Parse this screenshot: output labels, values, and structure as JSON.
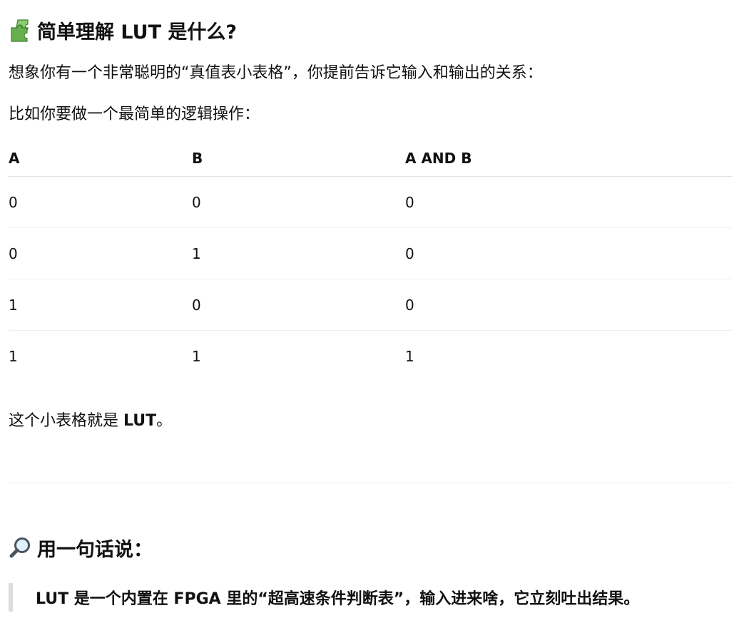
{
  "section1": {
    "icon": "puzzle-piece-icon",
    "title": "简单理解 LUT 是什么?",
    "intro": "想象你有一个非常聪明的“真值表小表格”，你提前告诉它输入和输出的关系：",
    "example": "比如你要做一个最简单的逻辑操作：",
    "table": {
      "headers": [
        "A",
        "B",
        "A AND B"
      ],
      "rows": [
        [
          "0",
          "0",
          "0"
        ],
        [
          "0",
          "1",
          "0"
        ],
        [
          "1",
          "0",
          "0"
        ],
        [
          "1",
          "1",
          "1"
        ]
      ]
    },
    "conclusion_prefix": "这个小表格就是 ",
    "conclusion_bold": "LUT",
    "conclusion_suffix": "。"
  },
  "section2": {
    "icon": "magnifying-glass-icon",
    "title": "用一句话说：",
    "quote": "LUT 是一个内置在 FPGA 里的“超高速条件判断表”，输入进来啥，它立刻吐出结果。"
  },
  "colors": {
    "text": "#111111",
    "divider": "#ececec",
    "quote_bar": "#dcdcdc",
    "puzzle_green": "#5fa84a"
  }
}
